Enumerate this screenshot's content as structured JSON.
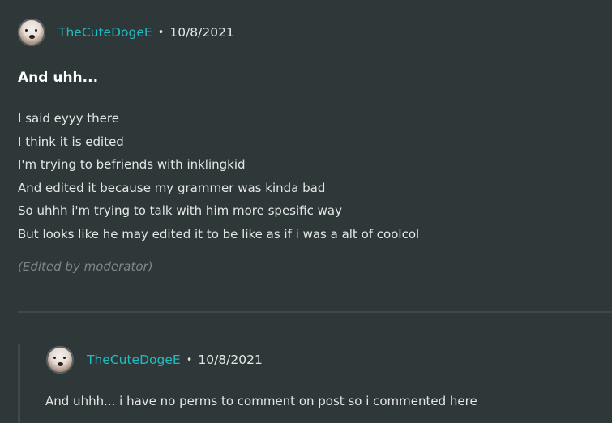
{
  "post": {
    "author": "TheCuteDogeE",
    "separator": "•",
    "date": "10/8/2021",
    "title": "And uhh...",
    "lines": [
      "I said eyyy there",
      "I think it is edited",
      "I'm trying to befriends with inklingkid",
      "And edited it because my grammer was kinda bad",
      "So uhhh i'm trying to talk with him more spesific way",
      "But looks like he may edited it to be like as if i was a alt of coolcol"
    ],
    "edited_note": "(Edited by moderator)"
  },
  "reply": {
    "author": "TheCuteDogeE",
    "separator": "•",
    "date": "10/8/2021",
    "body": "And uhhh... i have no perms to comment on post so i commented here"
  },
  "colors": {
    "background": "#2f3838",
    "username": "#1ebdc4",
    "text": "#e4e6e6",
    "muted": "#7e8686"
  }
}
